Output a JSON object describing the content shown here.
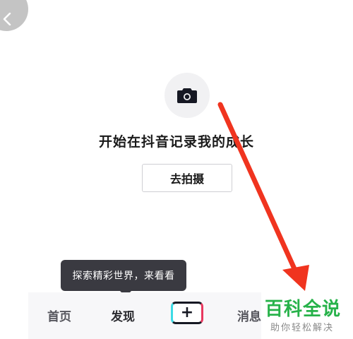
{
  "empty_state": {
    "message": "开始在抖音记录我的成长",
    "button_label": "去拍摄",
    "icon": "camera-icon"
  },
  "tooltip": {
    "text": "探索精彩世界，来看看"
  },
  "tabbar": {
    "home": "首页",
    "discover": "发现",
    "create": "+",
    "messages": "消息"
  },
  "watermark": {
    "title": "百科全说",
    "subtitle": "助你轻松解决"
  },
  "colors": {
    "arrow": "#f0341f",
    "watermark_green": "#27b24a",
    "tooltip_bg": "#3a3a41"
  }
}
